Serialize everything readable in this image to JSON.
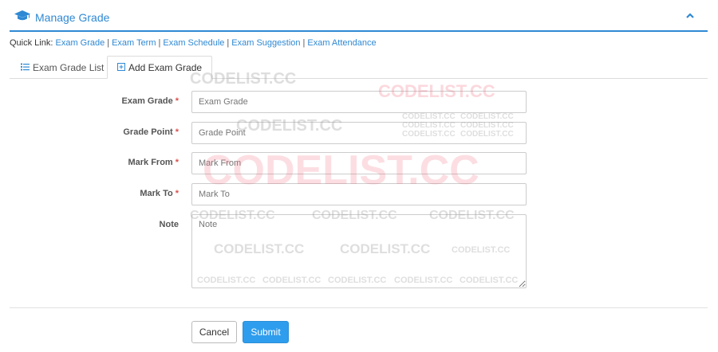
{
  "panel": {
    "title": "Manage Grade",
    "icon": "graduation-cap-icon",
    "collapse_icon": "chevron-up-icon",
    "accent_color": "#2f89d4"
  },
  "quick_links": {
    "prefix": "Quick Link:",
    "links": [
      "Exam Grade",
      "Exam Term",
      "Exam Schedule",
      "Exam Suggestion",
      "Exam Attendance"
    ]
  },
  "tabs": [
    {
      "label": "Exam Grade List",
      "icon": "list-icon",
      "active": false
    },
    {
      "label": "Add Exam Grade",
      "icon": "plus-square-icon",
      "active": true
    }
  ],
  "form": {
    "exam_grade": {
      "label": "Exam Grade",
      "required": "*",
      "placeholder": "Exam Grade"
    },
    "grade_point": {
      "label": "Grade Point",
      "required": "*",
      "placeholder": "Grade Point"
    },
    "mark_from": {
      "label": "Mark From",
      "required": "*",
      "placeholder": "Mark From"
    },
    "mark_to": {
      "label": "Mark To",
      "required": "*",
      "placeholder": "Mark To"
    },
    "note": {
      "label": "Note",
      "placeholder": "Note"
    }
  },
  "buttons": {
    "cancel": "Cancel",
    "submit": "Submit",
    "submit_color": "#2f9ded"
  },
  "watermarks": {
    "text": "CODELIST.CC"
  }
}
